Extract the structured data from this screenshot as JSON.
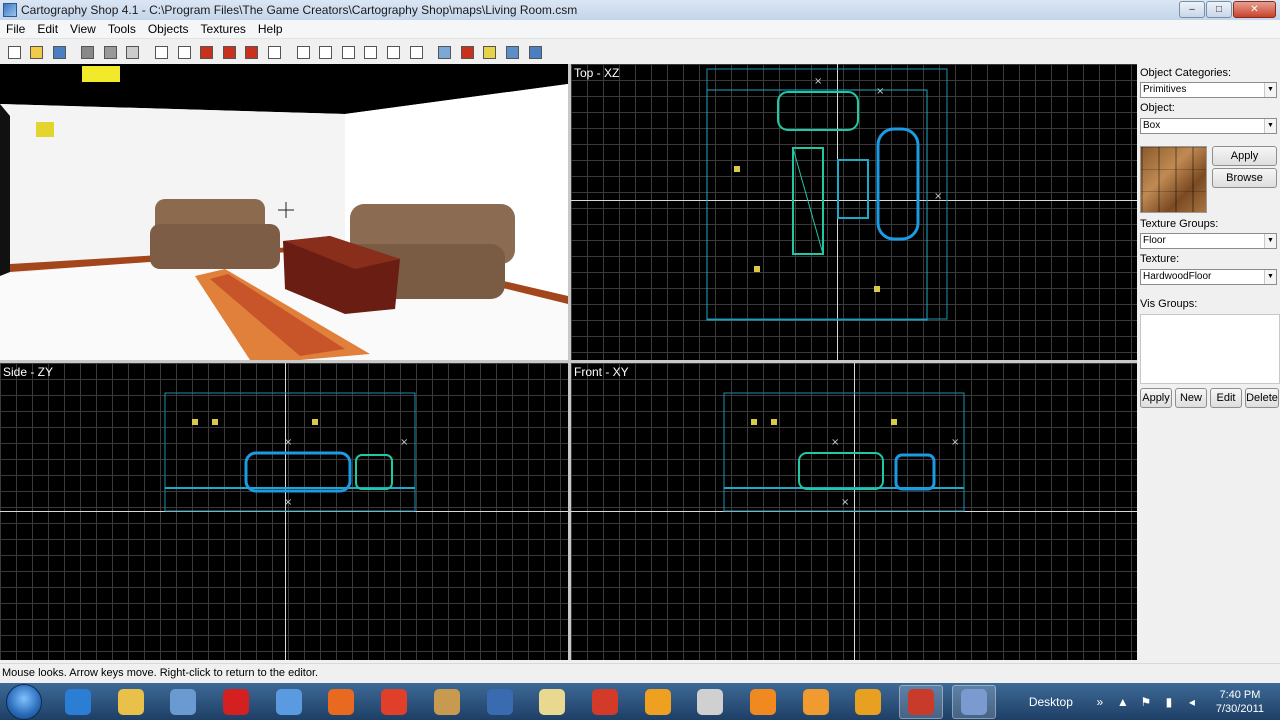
{
  "window": {
    "title": "Cartography Shop 4.1 - C:\\Program Files\\The Game Creators\\Cartography Shop\\maps\\Living Room.csm",
    "min": "–",
    "max": "□",
    "close": "✕"
  },
  "menu": [
    "File",
    "Edit",
    "View",
    "Tools",
    "Objects",
    "Textures",
    "Help"
  ],
  "toolbar_icons": [
    "new-file-icon",
    "open-folder-icon",
    "save-icon",
    "cut-icon",
    "copy-icon",
    "paste-icon",
    "box-icon",
    "cube-icon",
    "brick-wall-icon",
    "red-cube-icon",
    "red-box-icon",
    "red-box-outline-icon",
    "group-icon",
    "ungroup-icon",
    "layer-icon",
    "layer-stack-icon",
    "page-icon",
    "page-edit-icon",
    "eraser-icon",
    "texture-brick-icon",
    "light-bulb-icon",
    "settings-globe-icon",
    "help-icon"
  ],
  "viewports": {
    "perspective": "Perspective",
    "top": "Top - XZ",
    "side": "Side - ZY",
    "front": "Front - XY"
  },
  "panel": {
    "object_categories_label": "Object Categories:",
    "object_categories_value": "Primitives",
    "object_label": "Object:",
    "object_value": "Box",
    "apply": "Apply",
    "browse": "Browse",
    "texture_groups_label": "Texture Groups:",
    "texture_groups_value": "Floor",
    "texture_label": "Texture:",
    "texture_value": "HardwoodFloor",
    "vis_groups_label": "Vis Groups:",
    "vis_apply": "Apply",
    "vis_new": "New",
    "vis_edit": "Edit",
    "vis_delete": "Delete"
  },
  "status": "Mouse looks.  Arrow keys move.  Right-click to return to the editor.",
  "taskbar": {
    "apps": [
      "ie-icon",
      "explorer-folder-icon",
      "app-icon",
      "red-app-icon",
      "globe-icon",
      "firefox-icon",
      "chrome-icon",
      "game-icon",
      "media-grid-icon",
      "paint-icon",
      "color-blocks-icon",
      "play-icon",
      "tool-icon",
      "blender-icon",
      "blender-icon-2",
      "audio-icon",
      "green-app-icon",
      "cartography-icon"
    ],
    "desktop": "Desktop",
    "chevron": "»",
    "time": "7:40 PM",
    "date": "7/30/2011"
  }
}
